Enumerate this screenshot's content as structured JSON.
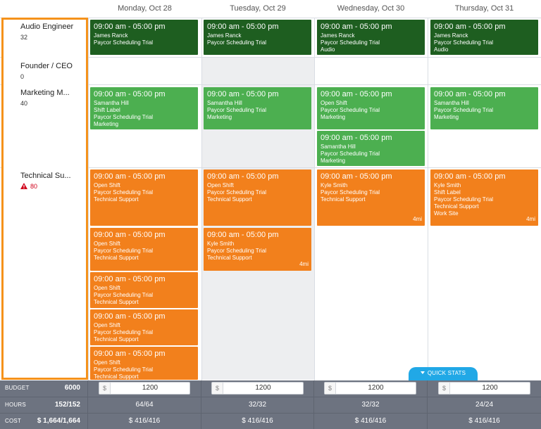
{
  "days": [
    "Monday, Oct 28",
    "Tuesday, Oct 29",
    "Wednesday, Oct 30",
    "Thursday, Oct 31"
  ],
  "roles": [
    {
      "name": "Audio Engineer",
      "count": "32",
      "warning": false
    },
    {
      "name": "Founder / CEO",
      "count": "0",
      "warning": false
    },
    {
      "name": "Marketing M...",
      "count": "40",
      "warning": false
    },
    {
      "name": "Technical Su...",
      "count": "80",
      "warning": true
    }
  ],
  "shifts": {
    "audio_mon": {
      "time": "09:00 am - 05:00 pm",
      "lines": [
        "James Ranck",
        "Paycor Scheduling Trial"
      ]
    },
    "audio_tue": {
      "time": "09:00 am - 05:00 pm",
      "lines": [
        "James Ranck",
        "Paycor Scheduling Trial"
      ]
    },
    "audio_wed": {
      "time": "09:00 am - 05:00 pm",
      "lines": [
        "James Ranck",
        "Paycor Scheduling Trial",
        "Audio"
      ]
    },
    "audio_thu": {
      "time": "09:00 am - 05:00 pm",
      "lines": [
        "James Ranck",
        "Paycor Scheduling Trial",
        "Audio"
      ]
    },
    "mkt_mon": {
      "time": "09:00 am - 05:00 pm",
      "lines": [
        "Samantha Hill",
        "Shift Label",
        "Paycor Scheduling Trial",
        "Marketing"
      ]
    },
    "mkt_tue": {
      "time": "09:00 am - 05:00 pm",
      "lines": [
        "Samantha Hill",
        "Paycor Scheduling Trial",
        "Marketing"
      ]
    },
    "mkt_wed1": {
      "time": "09:00 am - 05:00 pm",
      "lines": [
        "Open Shift",
        "Paycor Scheduling Trial",
        "Marketing"
      ]
    },
    "mkt_wed2": {
      "time": "09:00 am - 05:00 pm",
      "lines": [
        "Samantha Hill",
        "Paycor Scheduling Trial",
        "Marketing"
      ]
    },
    "mkt_thu": {
      "time": "09:00 am - 05:00 pm",
      "lines": [
        "Samantha Hill",
        "Paycor Scheduling Trial",
        "Marketing"
      ]
    },
    "tech_mon1": {
      "time": "09:00 am - 05:00 pm",
      "lines": [
        "Open Shift",
        "Paycor Scheduling Trial",
        "Technical Support"
      ]
    },
    "tech_mon2": {
      "time": "09:00 am - 05:00 pm",
      "lines": [
        "Open Shift",
        "Paycor Scheduling Trial",
        "Technical Support"
      ]
    },
    "tech_mon3": {
      "time": "09:00 am - 05:00 pm",
      "lines": [
        "Open Shift",
        "Paycor Scheduling Trial",
        "Technical Support"
      ]
    },
    "tech_mon4": {
      "time": "09:00 am - 05:00 pm",
      "lines": [
        "Open Shift",
        "Paycor Scheduling Trial",
        "Technical Support"
      ]
    },
    "tech_mon5": {
      "time": "09:00 am - 05:00 pm",
      "lines": [
        "Open Shift",
        "Paycor Scheduling Trial",
        "Technical Support"
      ]
    },
    "tech_tue1": {
      "time": "09:00 am - 05:00 pm",
      "lines": [
        "Open Shift",
        "Paycor Scheduling Trial",
        "Technical Support"
      ]
    },
    "tech_tue2": {
      "time": "09:00 am - 05:00 pm",
      "lines": [
        "Kyle Smith",
        "Paycor Scheduling Trial",
        "Technical Support"
      ],
      "distance": "4mi"
    },
    "tech_wed": {
      "time": "09:00 am - 05:00 pm",
      "lines": [
        "Kyle Smith",
        "Paycor Scheduling Trial",
        "Technical Support"
      ],
      "distance": "4mi"
    },
    "tech_thu": {
      "time": "09:00 am - 05:00 pm",
      "lines": [
        "Kyle Smith",
        "Shift Label",
        "Paycor Scheduling Trial",
        "Technical Support",
        "Work Site"
      ],
      "distance": "4mi"
    }
  },
  "quick_stats_label": "QUICK STATS",
  "footer": {
    "budget": {
      "label": "BUDGET",
      "total": "6000",
      "currency": "$",
      "values": [
        "1200",
        "1200",
        "1200",
        "1200"
      ]
    },
    "hours": {
      "label": "HOURS",
      "total": "152/152",
      "values": [
        "64/64",
        "32/32",
        "32/32",
        "24/24"
      ]
    },
    "cost": {
      "label": "COST",
      "total": "$ 1,664/1,664",
      "values": [
        "$ 416/416",
        "$ 416/416",
        "$ 416/416",
        "$ 416/416"
      ]
    }
  },
  "colors": {
    "dark_green": "#1e5e20",
    "green": "#4caf50",
    "orange": "#f2801c",
    "accent": "#f5921b",
    "quick_stats": "#21a8e6",
    "footer": "#6d7380"
  }
}
